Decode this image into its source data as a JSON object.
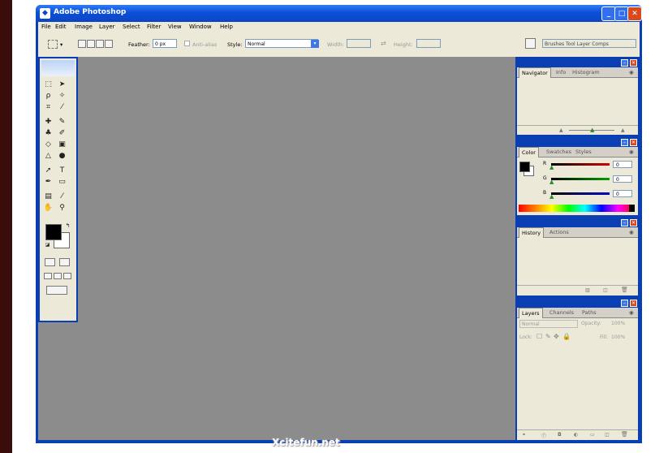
{
  "window": {
    "title": "Adobe Photoshop"
  },
  "menu": [
    "File",
    "Edit",
    "Image",
    "Layer",
    "Select",
    "Filter",
    "View",
    "Window",
    "Help"
  ],
  "options_bar": {
    "feather_label": "Feather:",
    "feather_value": "0 px",
    "antialias_label": "Anti-alias",
    "style_label": "Style:",
    "style_value": "Normal",
    "width_label": "Width:",
    "height_label": "Height:",
    "palette_well": "Brushes  Tool  Layer Comps"
  },
  "navigator_panel": {
    "tabs": [
      "Navigator",
      "Info",
      "Histogram"
    ]
  },
  "color_panel": {
    "tabs": [
      "Color",
      "Swatches",
      "Styles"
    ],
    "channels": [
      {
        "label": "R",
        "value": "0",
        "color": "#d40000"
      },
      {
        "label": "G",
        "value": "0",
        "color": "#00a000"
      },
      {
        "label": "B",
        "value": "0",
        "color": "#0000c8"
      }
    ]
  },
  "history_panel": {
    "tabs": [
      "History",
      "Actions"
    ]
  },
  "layers_panel": {
    "tabs": [
      "Layers",
      "Channels",
      "Paths"
    ],
    "blend_mode": "Normal",
    "opacity_label": "Opacity:",
    "opacity_value": "100%",
    "lock_label": "Lock:",
    "fill_label": "Fill:",
    "fill_value": "100%"
  },
  "watermark": "Xcitefun.net"
}
